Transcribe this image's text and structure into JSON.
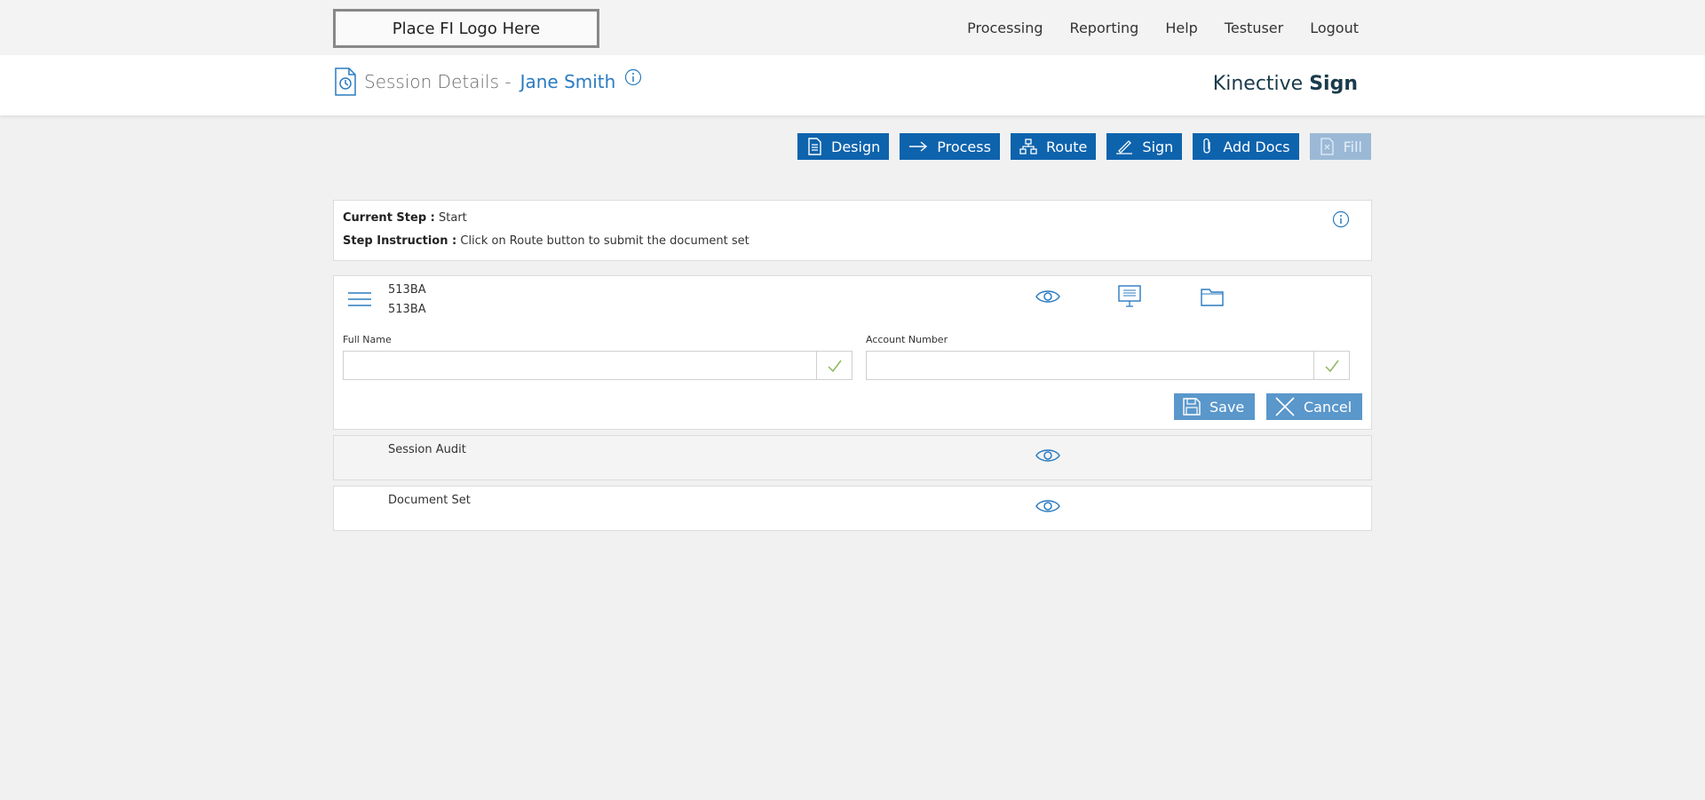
{
  "topbar": {
    "logo_text": "Place FI Logo Here",
    "nav": [
      "Processing",
      "Reporting",
      "Help",
      "Testuser",
      "Logout"
    ]
  },
  "header": {
    "title": "Session Details -",
    "name": "Jane Smith",
    "brand_light": "Kinective",
    "brand_bold": "Sign"
  },
  "toolbar": {
    "design": "Design",
    "process": "Process",
    "route": "Route",
    "sign": "Sign",
    "add_docs": "Add Docs",
    "fill": "Fill"
  },
  "step": {
    "current_label": "Current Step :",
    "current_value": "Start",
    "instruction_label": "Step Instruction :",
    "instruction_value": "Click on Route button to submit the document set"
  },
  "document": {
    "id_line1": "513BA",
    "id_line2": "513BA",
    "fields": [
      {
        "label": "Full Name",
        "value": ""
      },
      {
        "label": "Account Number",
        "value": ""
      }
    ],
    "save_label": "Save",
    "cancel_label": "Cancel"
  },
  "rows": {
    "audit_label": "Session Audit",
    "docset_label": "Document Set"
  },
  "colors": {
    "primary": "#0e63ad",
    "disabled": "#9bb9d6",
    "action": "#5a97cb",
    "accent_text": "#2a7bc0",
    "check": "#8cb85c"
  },
  "icons": [
    "session-history-icon",
    "info-icon",
    "design-icon",
    "arrow-right-icon",
    "route-icon",
    "pen-icon",
    "paperclip-icon",
    "fill-icon",
    "hamburger-menu-icon",
    "eye-icon",
    "presentation-icon",
    "folder-icon",
    "check-icon",
    "save-icon",
    "close-icon"
  ]
}
